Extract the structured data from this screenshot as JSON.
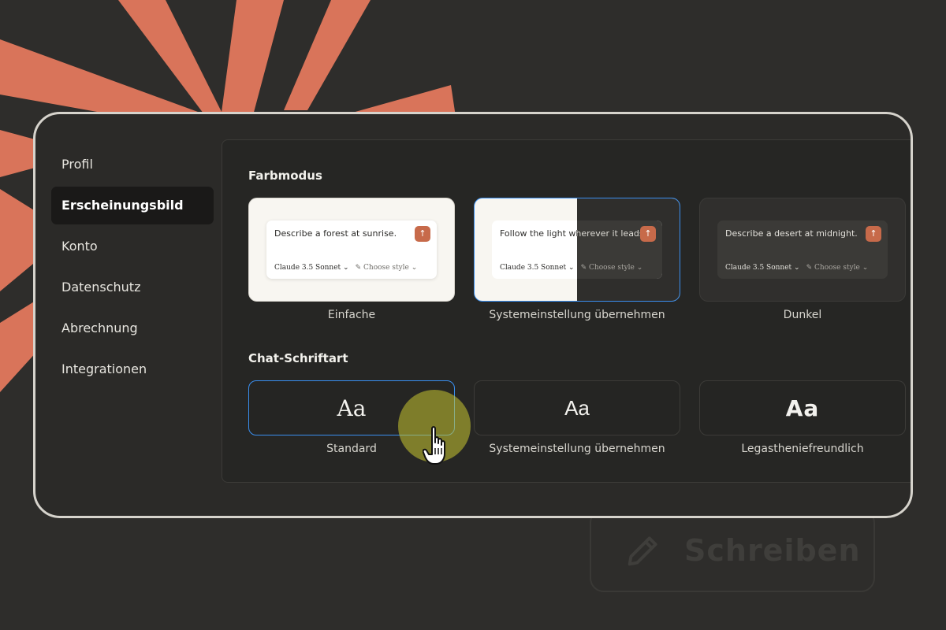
{
  "nav": {
    "items": [
      {
        "label": "Profil"
      },
      {
        "label": "Erscheinungsbild",
        "active": true
      },
      {
        "label": "Konto"
      },
      {
        "label": "Datenschutz"
      },
      {
        "label": "Abrechnung"
      },
      {
        "label": "Integrationen"
      }
    ]
  },
  "farbmodus": {
    "title": "Farbmodus",
    "options": [
      {
        "caption": "Einfache",
        "prompt": "Describe a forest at sunrise.",
        "model": "Claude 3.5 Sonnet",
        "style": "Choose style"
      },
      {
        "caption": "Systemeinstellung übernehmen",
        "prompt": "Follow the light wherever it leads.",
        "model": "Claude 3.5 Sonnet",
        "style": "Choose style",
        "selected": true
      },
      {
        "caption": "Dunkel",
        "prompt": "Describe a desert at midnight.",
        "model": "Claude 3.5 Sonnet",
        "style": "Choose style"
      }
    ]
  },
  "schriftart": {
    "title": "Chat-Schriftart",
    "options": [
      {
        "sample": "Aa",
        "caption": "Standard",
        "selected": true
      },
      {
        "sample": "Aa",
        "caption": "Systemeinstellung übernehmen"
      },
      {
        "sample": "Aa",
        "caption": "Legastheniefreundlich"
      }
    ]
  },
  "background_button": {
    "label": "Schreiben"
  },
  "colors": {
    "background": "#2e2d2b",
    "accent_orange": "#d9745a",
    "selection_blue": "#3a8ff0",
    "send_button": "#c76a4a",
    "cursor_highlight": "#c8c632"
  },
  "icons": {
    "send": "arrow-up-icon",
    "model_dropdown": "chevron-down-icon",
    "style": "feather-icon",
    "background_button": "pencil-icon",
    "cursor": "hand-pointer-icon"
  }
}
